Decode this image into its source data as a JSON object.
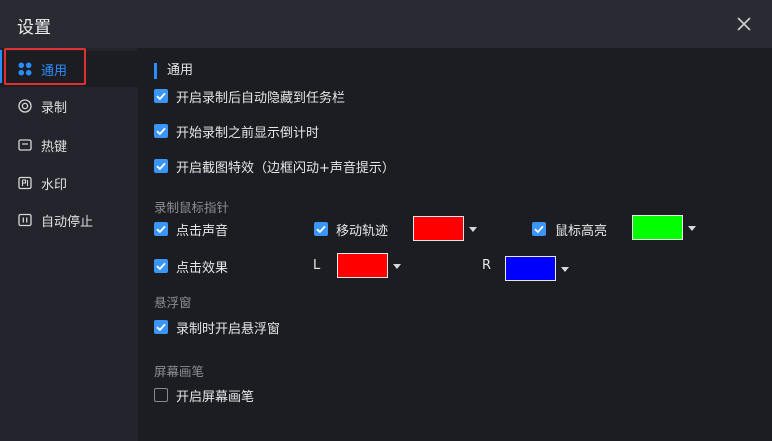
{
  "window": {
    "title": "设置",
    "close_icon": "close-icon"
  },
  "sidebar": {
    "items": [
      {
        "label": "通用",
        "icon": "grid-icon"
      },
      {
        "label": "录制",
        "icon": "record-icon"
      },
      {
        "label": "热键",
        "icon": "keyboard-icon"
      },
      {
        "label": "水印",
        "icon": "watermark-icon"
      },
      {
        "label": "自动停止",
        "icon": "timer-stop-icon"
      }
    ],
    "active_index": 0
  },
  "general": {
    "section_title": "通用",
    "options": [
      {
        "label": "开启录制后自动隐藏到任务栏",
        "checked": true
      },
      {
        "label": "开始录制之前显示倒计时",
        "checked": true
      },
      {
        "label": "开启截图特效（边框闪动+声音提示）",
        "checked": true
      }
    ]
  },
  "mouse": {
    "group_label": "录制鼠标指针",
    "click_sound": {
      "label": "点击声音",
      "checked": true
    },
    "trail": {
      "label": "移动轨迹",
      "checked": true,
      "color": "#ff0000"
    },
    "highlight": {
      "label": "鼠标高亮",
      "checked": true,
      "color": "#00ff00"
    },
    "click_effect": {
      "label": "点击效果",
      "checked": true
    },
    "left": {
      "label": "L",
      "color": "#ff0000"
    },
    "right": {
      "label": "R",
      "color": "#0000ff"
    }
  },
  "float": {
    "group_label": "悬浮窗",
    "option": {
      "label": "录制时开启悬浮窗",
      "checked": true
    }
  },
  "pen": {
    "group_label": "屏幕画笔",
    "option": {
      "label": "开启屏幕画笔",
      "checked": false
    }
  },
  "theme": {
    "accent": "#2a8cff",
    "highlight_border": "#e03131"
  }
}
